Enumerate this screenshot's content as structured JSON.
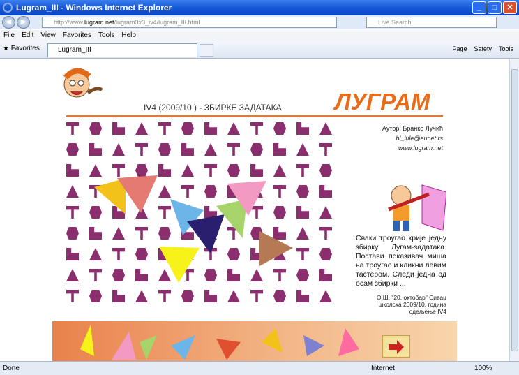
{
  "window": {
    "title": "Lugram_III - Windows Internet Explorer"
  },
  "address": {
    "url_prefix": "http://www.",
    "url_domain": "lugram.net",
    "url_rest": "/lugram3x3_iv4/lugram_III.html",
    "search_placeholder": "Live Search"
  },
  "menu": [
    "File",
    "Edit",
    "View",
    "Favorites",
    "Tools",
    "Help"
  ],
  "favbar": {
    "favorites": "Favorites",
    "tab": "Lugram_III",
    "tools": [
      "Page",
      "Safety",
      "Tools"
    ]
  },
  "page": {
    "title": "IV4 (2009/10.) - ЗБИРКЕ ЗАДАТАКА",
    "logo": "ЛУГРАМ",
    "author": "Аутор: Бранко Лучић",
    "email": "bl_lule@eunet.rs",
    "site": "www.lugram.net",
    "description": "Сваки троугао крије једну збирку Лугам-задатака. Постави показивач миша на троугао и кликни левим тастером. Следи једна од осам збирки ...",
    "school": "О.Ш. \"20. октобар\" Сивац школска 2009/10. година одељење IV4"
  },
  "triangles": [
    {
      "color": "#f2c21a"
    },
    {
      "color": "#e57a72"
    },
    {
      "color": "#6bb5e8"
    },
    {
      "color": "#2a1f6e"
    },
    {
      "color": "#a6d36a"
    },
    {
      "color": "#f29ac2"
    },
    {
      "color": "#f6f21a"
    },
    {
      "color": "#b57a54"
    }
  ],
  "status": {
    "left": "Done",
    "zone": "Internet",
    "zoom": "100%"
  },
  "colors": {
    "glyph": "#8b2e6e",
    "accent": "#e86c1a"
  }
}
